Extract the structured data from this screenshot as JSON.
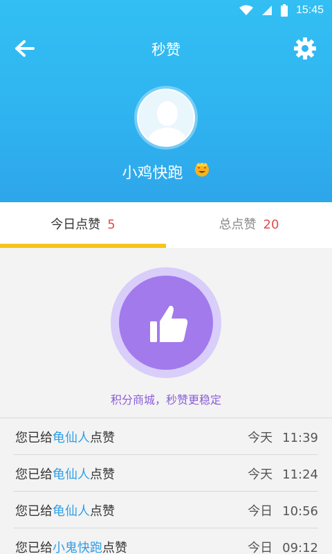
{
  "status_bar": {
    "time": "15:45",
    "icons": [
      "wifi-icon",
      "signal-icon",
      "battery-icon"
    ]
  },
  "header": {
    "title": "秒赞",
    "back_icon": "back-arrow-icon",
    "settings_icon": "gear-icon"
  },
  "profile": {
    "username": "小鸡快跑",
    "badge_icon": "smiling-face-heart-eyes-icon"
  },
  "tabs": [
    {
      "label": "今日点赞",
      "count": "5",
      "active": true
    },
    {
      "label": "总点赞",
      "count": "20",
      "active": false
    }
  ],
  "like": {
    "icon": "thumbs-up-icon",
    "caption": "积分商城，秒赞更稳定"
  },
  "logs": [
    {
      "prefix": "您已给",
      "who": "龟仙人",
      "suffix": "点赞",
      "day": "今天",
      "time": "11:39"
    },
    {
      "prefix": "您已给",
      "who": "龟仙人",
      "suffix": "点赞",
      "day": "今天",
      "time": "11:24"
    },
    {
      "prefix": "您已给",
      "who": "龟仙人",
      "suffix": "点赞",
      "day": "今日",
      "time": "10:56"
    },
    {
      "prefix": "您已给",
      "who": "小鬼快跑",
      "suffix": "点赞",
      "day": "今日",
      "time": "09:12"
    }
  ],
  "colors": {
    "header": "#33bff3",
    "accent_purple": "#a27aec",
    "tab_indicator": "#f5c518",
    "count_red": "#e54b4b",
    "link_blue": "#2f9fe6"
  }
}
